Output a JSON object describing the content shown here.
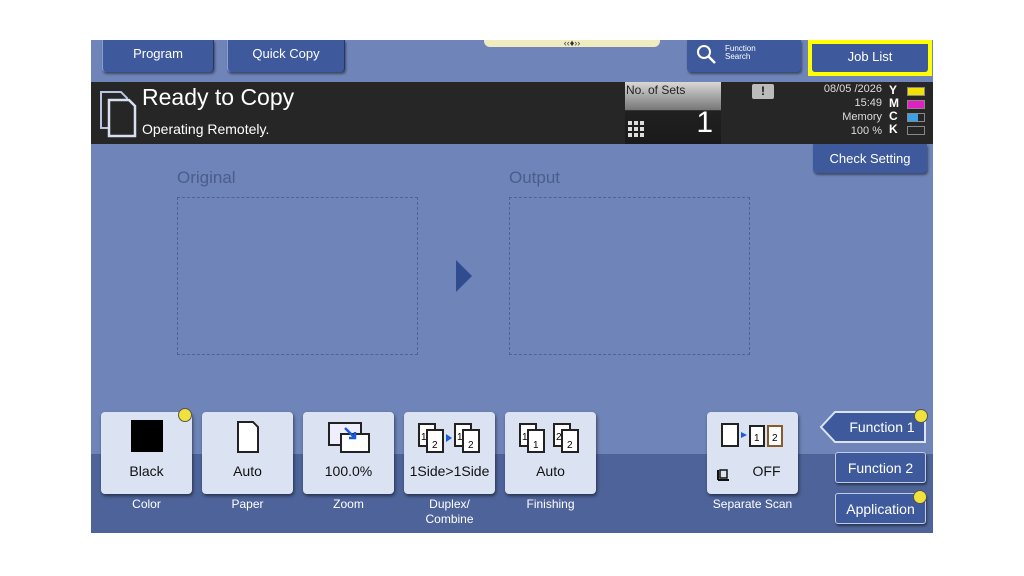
{
  "top_bar": {
    "program_label": "Program",
    "quick_copy_label": "Quick Copy",
    "function_search_line1": "Function",
    "function_search_line2": "Search",
    "job_list_label": "Job List",
    "handle_glyph": "‹‹♦››"
  },
  "status": {
    "title": "Ready to Copy",
    "subtitle": "Operating Remotely.",
    "sets_label": "No. of Sets",
    "sets_value": "1",
    "alert_glyph": "!",
    "date": "08/05 /2026",
    "time": "15:49",
    "memory_label": "Memory",
    "memory_value": "100 %",
    "toner": [
      {
        "letter": "Y",
        "color": "#f2e000",
        "level": 1.0
      },
      {
        "letter": "M",
        "color": "#e020c0",
        "level": 1.0
      },
      {
        "letter": "C",
        "color": "#3aa0e8",
        "level": 0.6
      },
      {
        "letter": "K",
        "color": "#222222",
        "level": 0.0
      }
    ],
    "check_setting_label": "Check Setting"
  },
  "main": {
    "original_label": "Original",
    "output_label": "Output"
  },
  "settings": [
    {
      "value": "Black",
      "caption": "Color",
      "icon": "black-square-icon"
    },
    {
      "value": "Auto",
      "caption": "Paper",
      "icon": "paper-sheet-icon"
    },
    {
      "value": "100.0%",
      "caption": "Zoom",
      "icon": "zoom-icon"
    },
    {
      "value": "1Side>1Side",
      "caption": "Duplex/ Combine",
      "icon": "duplex-icon"
    },
    {
      "value": "Auto",
      "caption": "Finishing",
      "icon": "finishing-icon"
    },
    {
      "value": "OFF",
      "caption": "Separate Scan",
      "icon": "separate-scan-icon"
    }
  ],
  "functions": {
    "function1": "Function 1",
    "function2": "Function 2",
    "application": "Application"
  },
  "colors": {
    "screen_bg": "#6f84b8",
    "button_blue": "#3e5a9c",
    "highlight": "#ffff00"
  }
}
